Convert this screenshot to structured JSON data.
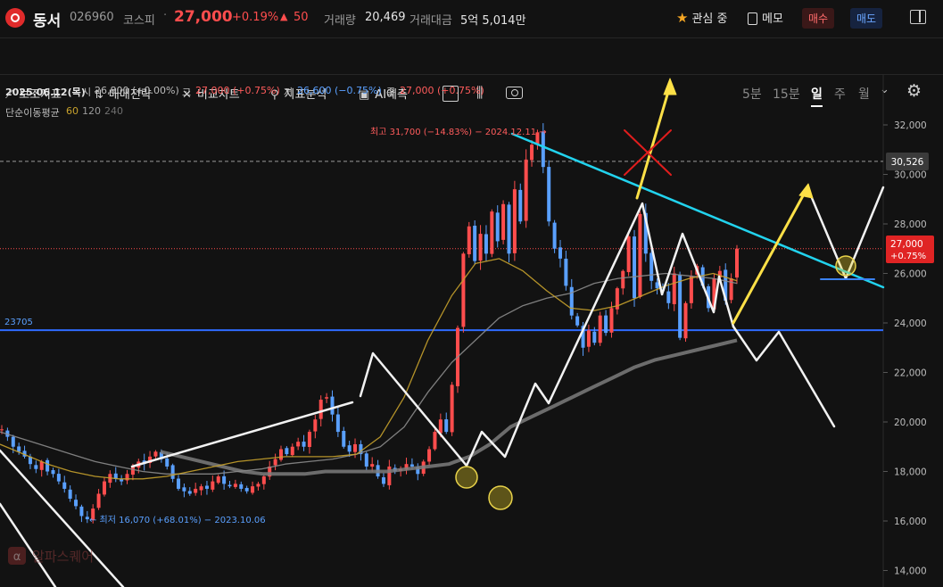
{
  "header": {
    "name": "동서",
    "code": "026960",
    "market": "코스피",
    "dot": "·",
    "price": "27,000",
    "change_pct": "+0.19%",
    "change_symbol": "▲",
    "change": "50",
    "volume_label": "거래량",
    "volume": "20,469",
    "amount_label": "거래대금",
    "amount": "5억 5,014만",
    "watch_label": "관심 중",
    "memo_label": "메모",
    "buy_label": "매수",
    "sell_label": "매도"
  },
  "toolbar": {
    "items": [
      "보조지표",
      "매매전략",
      "비교차트",
      "지표분석",
      "AI예측"
    ],
    "periods": [
      "5분",
      "15분",
      "일",
      "주",
      "월"
    ],
    "selected_period": "일"
  },
  "info": {
    "date": "2025.06.12(목)",
    "open_label": "시",
    "open": "26,800 (+0.00%)",
    "high_label": "고",
    "high": "27,000 (+0.75%)",
    "low_label": "저",
    "low": "26,600 (−0.75%)",
    "close_label": "종",
    "close": "27,000 (+0.75%)"
  },
  "ma_legend": {
    "label": "단순이동평균",
    "periods": [
      "60",
      "120",
      "240"
    ]
  },
  "colors": {
    "up": "#ff4d4d",
    "down": "#5aa0ff",
    "ma60": "#c8a22c",
    "ma120": "#8c8c8c",
    "ma240": "#7c7c7c",
    "support": "#2f6bff",
    "trendline": "#22d3ee",
    "arrow": "#fde047",
    "drawing": "#ffffff"
  },
  "chart_data": {
    "type": "candlestick",
    "period": "daily",
    "x_range": [
      "2023-07",
      "2025-06-12"
    ],
    "ylim": [
      14000,
      33000
    ],
    "y_ticks": [
      "14,000",
      "16,000",
      "18,000",
      "20,000",
      "22,000",
      "24,000",
      "26,000",
      "28,000",
      "30,000",
      "32,000"
    ],
    "y_tick_values": [
      14000,
      16000,
      18000,
      20000,
      22000,
      24000,
      26000,
      28000,
      30000,
      32000
    ],
    "close_series_approx": [
      19700,
      19400,
      19000,
      18800,
      18600,
      18300,
      18100,
      18400,
      18000,
      17900,
      17600,
      17300,
      16900,
      16600,
      16200,
      16070,
      16500,
      17100,
      17600,
      17900,
      17700,
      17600,
      17900,
      18200,
      18400,
      18300,
      18600,
      18800,
      18500,
      18200,
      17700,
      17300,
      17200,
      17100,
      17300,
      17400,
      17300,
      17600,
      17800,
      17500,
      17400,
      17500,
      17300,
      17200,
      17400,
      17500,
      17800,
      18200,
      18500,
      18900,
      18700,
      19000,
      19200,
      19000,
      19600,
      20100,
      20900,
      21000,
      20300,
      19600,
      19000,
      18800,
      19100,
      18700,
      18200,
      18300,
      17800,
      17500,
      18200,
      18000,
      18100,
      18300,
      18200,
      17900,
      18400,
      18900,
      19600,
      20100,
      19600,
      21500,
      23800,
      26800,
      27900,
      26500,
      27600,
      26800,
      28500,
      27300,
      28800,
      26800,
      29400,
      28100,
      30600,
      31200,
      31700,
      30300,
      28100,
      27000,
      26600,
      25500,
      24300,
      23900,
      23000,
      23700,
      23200,
      24300,
      23600,
      24600,
      25400,
      26100,
      27500,
      25000,
      28400,
      26800,
      25700,
      25400,
      25300,
      24800,
      26000,
      23400,
      24800,
      25900,
      26300,
      25500,
      24600,
      25800,
      26100,
      24900,
      25800,
      27000
    ],
    "ma_series_approx": {
      "60": [
        19100,
        18700,
        18300,
        18000,
        17800,
        17700,
        17700,
        17800,
        18000,
        18200,
        18400,
        18500,
        18600,
        18600,
        18600,
        18700,
        19400,
        21000,
        23300,
        25100,
        26400,
        26600,
        26100,
        25300,
        24600,
        24500,
        24700,
        25100,
        25500,
        25800,
        26000,
        25700
      ],
      "120": [
        19600,
        19300,
        19000,
        18700,
        18400,
        18200,
        18000,
        17900,
        17900,
        17900,
        18000,
        18100,
        18300,
        18400,
        18500,
        18700,
        19000,
        19800,
        21200,
        22400,
        23300,
        24200,
        24700,
        25000,
        25200,
        25600,
        25800,
        25900,
        26000,
        25900,
        25800,
        25600
      ],
      "240": [
        18800,
        18600,
        18400,
        18200,
        18000,
        17900,
        17900,
        17900,
        18000,
        18000,
        18000,
        18000,
        18100,
        18200,
        18300,
        18600,
        19100,
        19800,
        20200,
        20600,
        21000,
        21400,
        21800,
        22200,
        22500,
        22700,
        22900,
        23100,
        23300
      ]
    },
    "current_price": 27000,
    "current_price_label": "27,000",
    "current_price_pct": "+0.75%",
    "level_marker": "30,526",
    "level_marker_value": 30526,
    "support_value": 23705,
    "support_label": "23705",
    "high_annotation": "최고 31,700 (−14.83%) − 2024.12.11 →",
    "low_annotation": "← 최저 16,070 (+68.01%) − 2023.10.06",
    "watermark": "알파스퀘어"
  }
}
